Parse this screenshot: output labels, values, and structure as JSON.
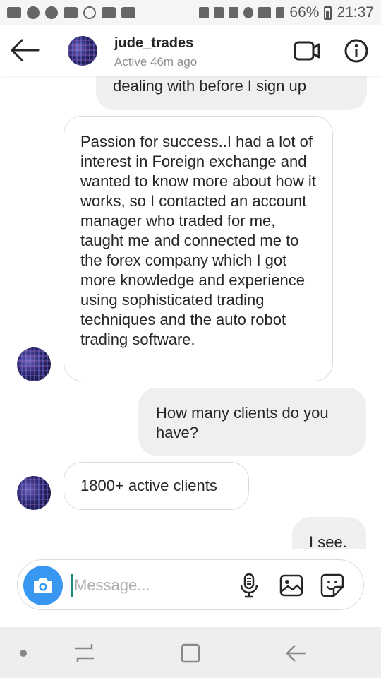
{
  "status_bar": {
    "battery": "66%",
    "time": "21:37"
  },
  "header": {
    "username": "jude_trades",
    "status": "Active 46m ago",
    "icons": [
      "back-arrow-icon",
      "video-call-icon",
      "info-icon"
    ]
  },
  "messages": [
    {
      "direction": "out",
      "text": "dealing with before I sign up"
    },
    {
      "direction": "in",
      "text": "Passion for success..I had a lot of interest in Foreign exchange and wanted to know more about how it works, so I contacted an account manager who traded for me, taught me and connected me to the forex company which I got more knowledge and experience using sophisticated trading techniques and the auto robot trading software."
    },
    {
      "direction": "out",
      "text": "How many clients do you have?"
    },
    {
      "direction": "in",
      "text": "1800+ active clients"
    },
    {
      "direction": "out",
      "text": "I see."
    }
  ],
  "composer": {
    "placeholder": "Message...",
    "value": "",
    "icons": [
      "camera-icon",
      "microphone-icon",
      "gallery-icon",
      "sticker-icon"
    ]
  },
  "colors": {
    "accent": "#3897f0",
    "outgoing_bubble": "#efefef",
    "incoming_border": "#dbdbdb",
    "secondary_text": "#8e8e8e"
  }
}
